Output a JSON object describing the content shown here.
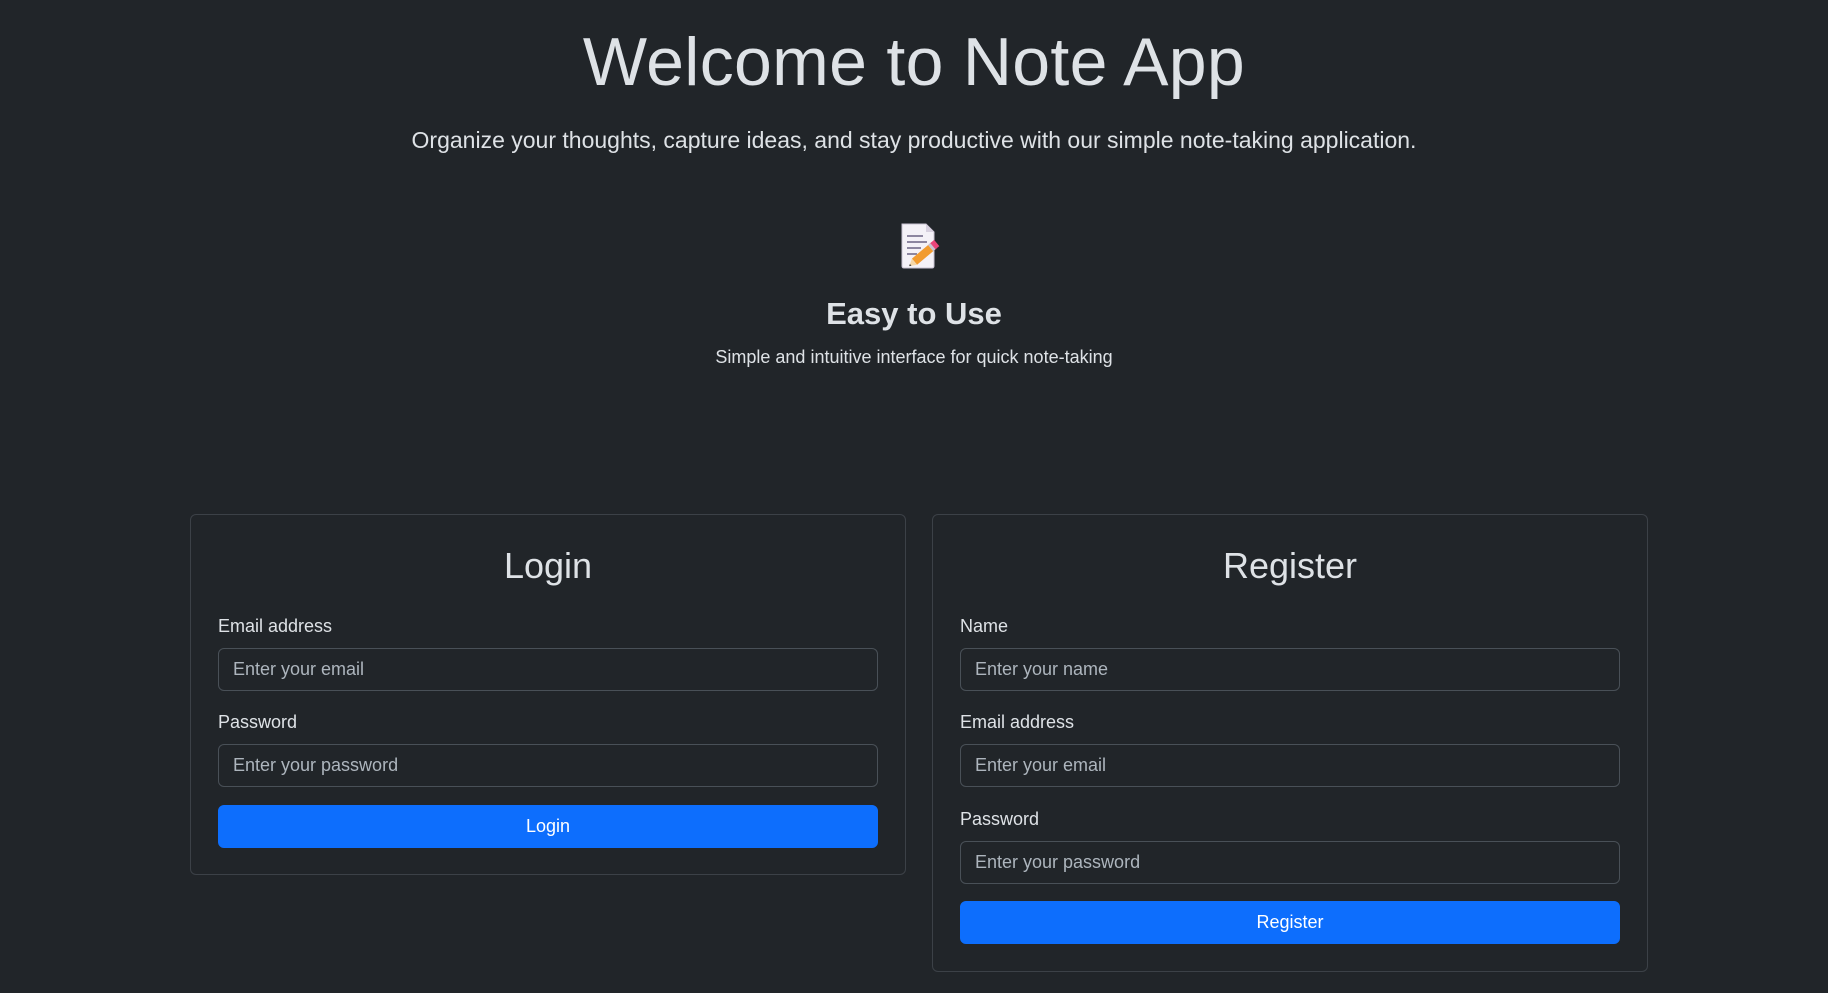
{
  "hero": {
    "title": "Welcome to Note App",
    "lead": "Organize your thoughts, capture ideas, and stay productive with our simple note-taking application."
  },
  "feature": {
    "icon": "memo-icon",
    "title": "Easy to Use",
    "text": "Simple and intuitive interface for quick note-taking"
  },
  "login": {
    "title": "Login",
    "email_label": "Email address",
    "email_placeholder": "Enter your email",
    "email_value": "",
    "password_label": "Password",
    "password_placeholder": "Enter your password",
    "password_value": "",
    "submit_label": "Login"
  },
  "register": {
    "title": "Register",
    "name_label": "Name",
    "name_placeholder": "Enter your name",
    "name_value": "",
    "email_label": "Email address",
    "email_placeholder": "Enter your email",
    "email_value": "",
    "password_label": "Password",
    "password_placeholder": "Enter your password",
    "password_value": "",
    "submit_label": "Register"
  },
  "colors": {
    "background": "#212529",
    "text": "#dee2e6",
    "primary": "#0d6efd",
    "border": "#495057"
  }
}
